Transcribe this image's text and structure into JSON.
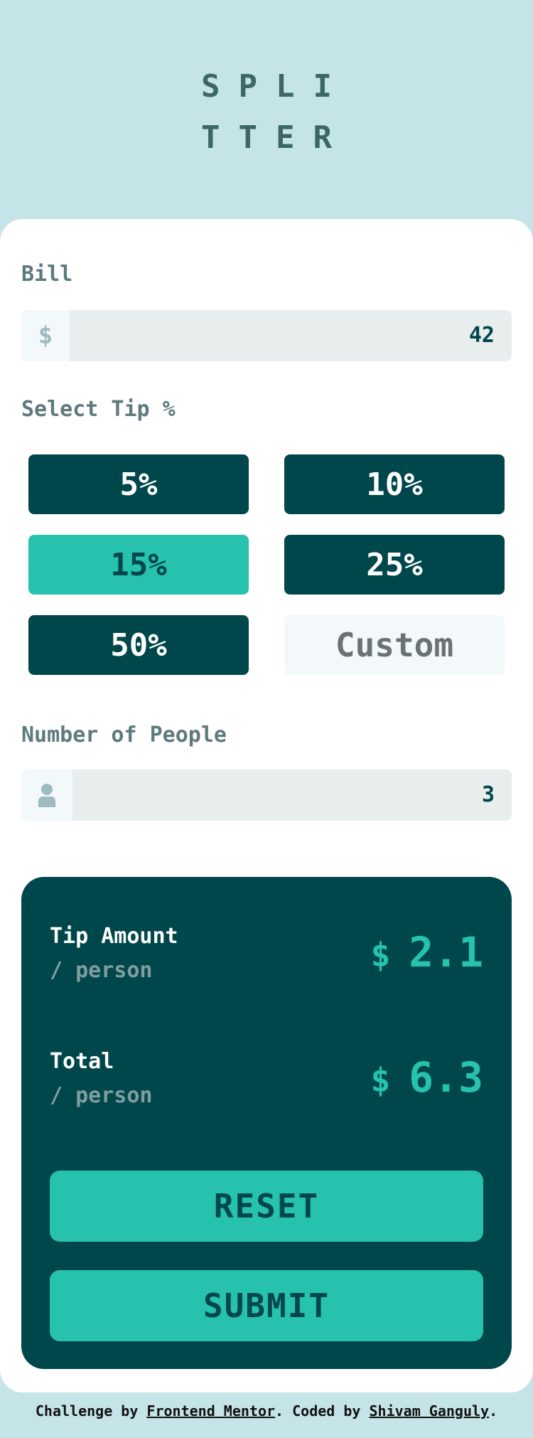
{
  "logo": {
    "line1": "SPLI",
    "line2": "TTER"
  },
  "bill": {
    "label": "Bill",
    "currency_symbol": "$",
    "value": "42"
  },
  "tip": {
    "label": "Select Tip %",
    "options": [
      {
        "label": "5%",
        "selected": false
      },
      {
        "label": "10%",
        "selected": false
      },
      {
        "label": "15%",
        "selected": true
      },
      {
        "label": "25%",
        "selected": false
      },
      {
        "label": "50%",
        "selected": false
      }
    ],
    "custom_placeholder": "Custom"
  },
  "people": {
    "label": "Number of People",
    "icon": "person-icon",
    "value": "3"
  },
  "results": {
    "tip_amount": {
      "title": "Tip Amount",
      "sub": "/ person",
      "currency": "$",
      "value": "2.1"
    },
    "total": {
      "title": "Total",
      "sub": "/ person",
      "currency": "$",
      "value": "6.3"
    },
    "reset_label": "RESET",
    "submit_label": "SUBMIT"
  },
  "footer": {
    "prefix": "Challenge by ",
    "link1": "Frontend Mentor",
    "middle": ". Coded by ",
    "link2": "Shivam Ganguly",
    "suffix": "."
  },
  "colors": {
    "background": "#c5e4e7",
    "dark_cyan": "#00474b",
    "strong_cyan": "#26c2ae",
    "input_bg": "#e8edee"
  }
}
